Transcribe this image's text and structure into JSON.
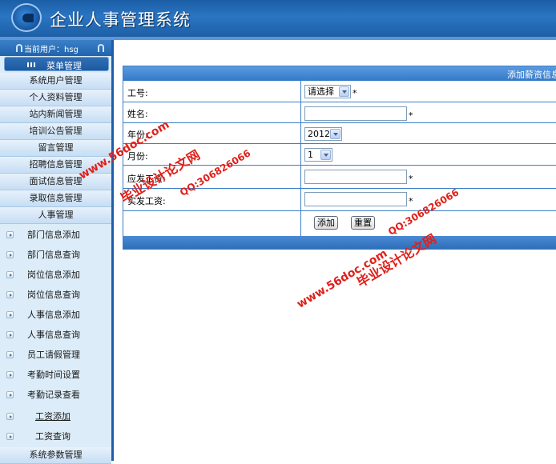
{
  "header": {
    "title": "企业人事管理系统",
    "logo_icon": "company-logo-icon"
  },
  "user_bar": {
    "label": "当前用户：hsg"
  },
  "menu": {
    "title": "菜单管理",
    "categories_top": [
      "系统用户管理",
      "个人资料管理",
      "站内新闻管理",
      "培训公告管理",
      "留言管理",
      "招聘信息管理",
      "面试信息管理",
      "录取信息管理",
      "人事管理"
    ],
    "subitems": [
      "部门信息添加",
      "部门信息查询",
      "岗位信息添加",
      "岗位信息查询",
      "人事信息添加",
      "人事信息查询",
      "员工请假管理",
      "考勤时间设置",
      "考勤记录查看",
      "工资添加",
      "工资查询"
    ],
    "category_bottom": "系统参数管理"
  },
  "form": {
    "header": "添加薪资信息",
    "fields": {
      "emp_no": {
        "label": "工号:",
        "value": "请选择"
      },
      "name": {
        "label": "姓名:",
        "value": ""
      },
      "year": {
        "label": "年份:",
        "value": "2012"
      },
      "month": {
        "label": "月份:",
        "value": "1"
      },
      "gross_pay": {
        "label": "应发工资:",
        "value": ""
      },
      "net_pay": {
        "label": "实发工资:",
        "value": ""
      }
    },
    "required_mark": "*",
    "buttons": {
      "add": "添加",
      "reset": "重置"
    }
  },
  "watermark": {
    "site": "www.56doc.com",
    "qq": "QQ:306826066",
    "name": "毕业设计论文网",
    "color": "#e0201a"
  },
  "colors": {
    "header": "#1b5ea6",
    "sidebar": "#dcecf8",
    "border": "#3b7ec8"
  }
}
